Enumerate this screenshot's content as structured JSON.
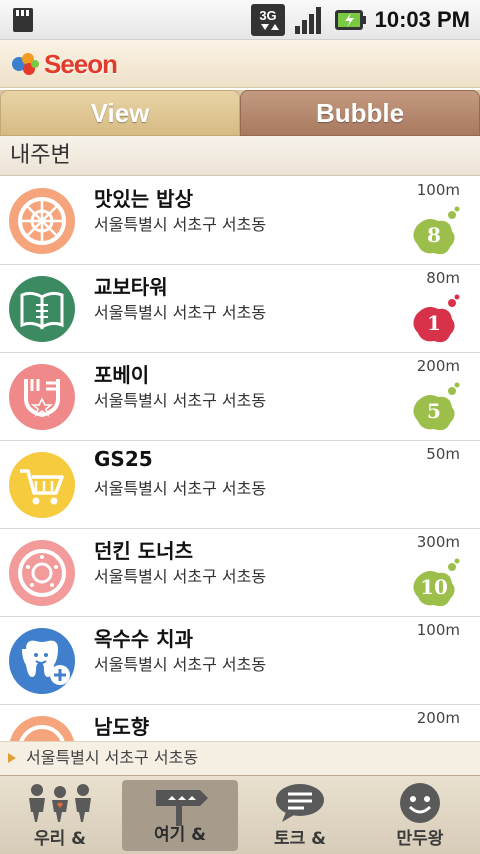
{
  "statusbar": {
    "network": "3G",
    "time": "10:03 PM"
  },
  "app": {
    "logo_text": "Seeon"
  },
  "tabs": [
    {
      "label": "View",
      "active": true
    },
    {
      "label": "Bubble",
      "active": false
    }
  ],
  "section_title": "내주변",
  "places": [
    {
      "name": "맛있는 밥상",
      "address": "서울특별시 서초구 서초동",
      "distance": "100m",
      "bubble": "8",
      "bubble_color": "#9bbf4a",
      "icon": "restaurant-icon"
    },
    {
      "name": "교보타워",
      "address": "서울특별시 서초구 서초동",
      "distance": "80m",
      "bubble": "1",
      "bubble_color": "#d8324a",
      "icon": "book-icon"
    },
    {
      "name": "포베이",
      "address": "서울특별시 서초구 서초동",
      "distance": "200m",
      "bubble": "5",
      "bubble_color": "#9bbf4a",
      "icon": "fork-star-icon"
    },
    {
      "name": "GS25",
      "address": "서울특별시 서초구 서초동",
      "distance": "50m",
      "bubble": "",
      "bubble_color": "",
      "icon": "cart-icon"
    },
    {
      "name": "던킨 도너츠",
      "address": "서울특별시 서초구 서초동",
      "distance": "300m",
      "bubble": "10",
      "bubble_color": "#9bbf4a",
      "icon": "donut-icon"
    },
    {
      "name": "옥수수 치과",
      "address": "서울특별시 서초구 서초동",
      "distance": "100m",
      "bubble": "",
      "bubble_color": "",
      "icon": "tooth-icon"
    },
    {
      "name": "남도향",
      "address": "",
      "distance": "200m",
      "bubble": "",
      "bubble_color": "",
      "icon": "restaurant-icon"
    }
  ],
  "location_bar": "서울특별시 서초구 서초동",
  "bottom_nav": [
    {
      "label": "우리 &",
      "icon": "people-icon",
      "active": false
    },
    {
      "label": "여기 &",
      "icon": "signpost-icon",
      "active": true
    },
    {
      "label": "토크 &",
      "icon": "chat-icon",
      "active": false
    },
    {
      "label": "만두왕",
      "icon": "smiley-icon",
      "active": false
    }
  ]
}
